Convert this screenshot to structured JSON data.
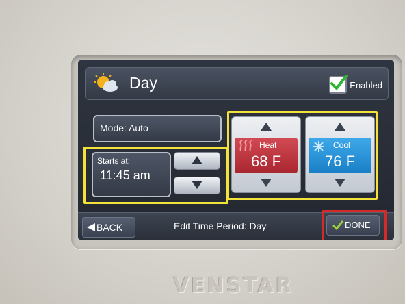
{
  "header": {
    "title": "Day",
    "weather_icon": "sun-cloud-icon",
    "enabled_label": "Enabled",
    "enabled_checked": true
  },
  "mode": {
    "label": "Mode: Auto"
  },
  "start_time": {
    "label": "Starts at:",
    "value": "11:45 am"
  },
  "setpoints": {
    "heat": {
      "label": "Heat",
      "value": "68 F",
      "color": "#c0343d",
      "icon": "heat-waves-icon"
    },
    "cool": {
      "label": "Cool",
      "value": "76 F",
      "color": "#2a93db",
      "icon": "snowflake-icon"
    }
  },
  "footer": {
    "back_label": "BACK",
    "title": "Edit Time Period: Day",
    "done_label": "DONE"
  },
  "device": {
    "brand": "VENSTAR"
  },
  "highlights": {
    "yellow": "#f2e23a",
    "red": "#d42a2a"
  }
}
